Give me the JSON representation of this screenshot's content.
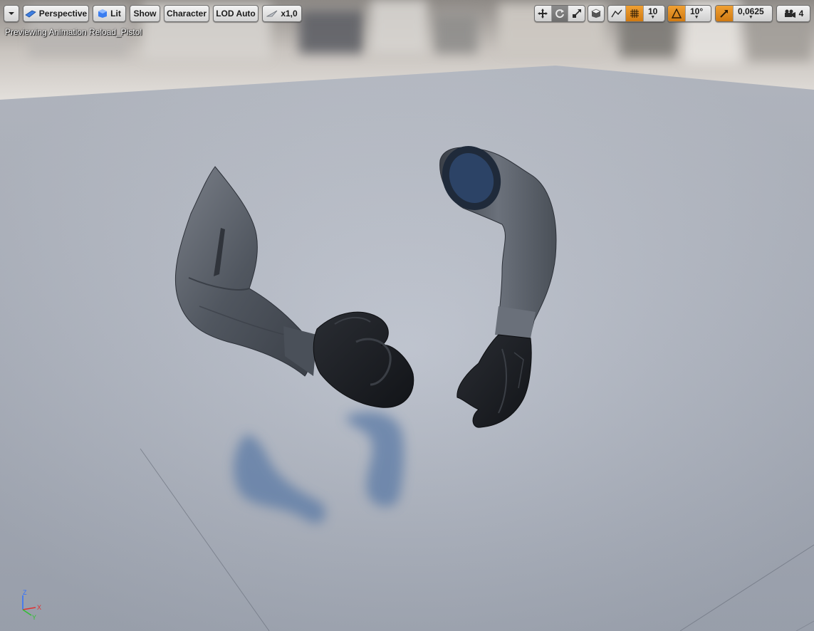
{
  "toolbar": {
    "left": {
      "menu_dropdown_icon": "chevron-down-icon",
      "perspective_label": "Perspective",
      "lit_label": "Lit",
      "show_label": "Show",
      "character_label": "Character",
      "lod_label": "LOD Auto",
      "speed_label": "x1,0"
    },
    "right": {
      "grid_snap_value": "10",
      "rotation_snap_value": "10°",
      "scale_snap_value": "0,0625",
      "camera_speed_value": "4"
    }
  },
  "viewport": {
    "preview_text": "Previewing Animation Reload_Pistol",
    "axis_labels": {
      "z": "Z",
      "x": "X",
      "y": "Y"
    }
  },
  "colors": {
    "accent_orange": "#e08a1e",
    "axis_x": "#e03030",
    "axis_y": "#30c030",
    "axis_z": "#3070ff",
    "floor": "#b4bbc8"
  }
}
